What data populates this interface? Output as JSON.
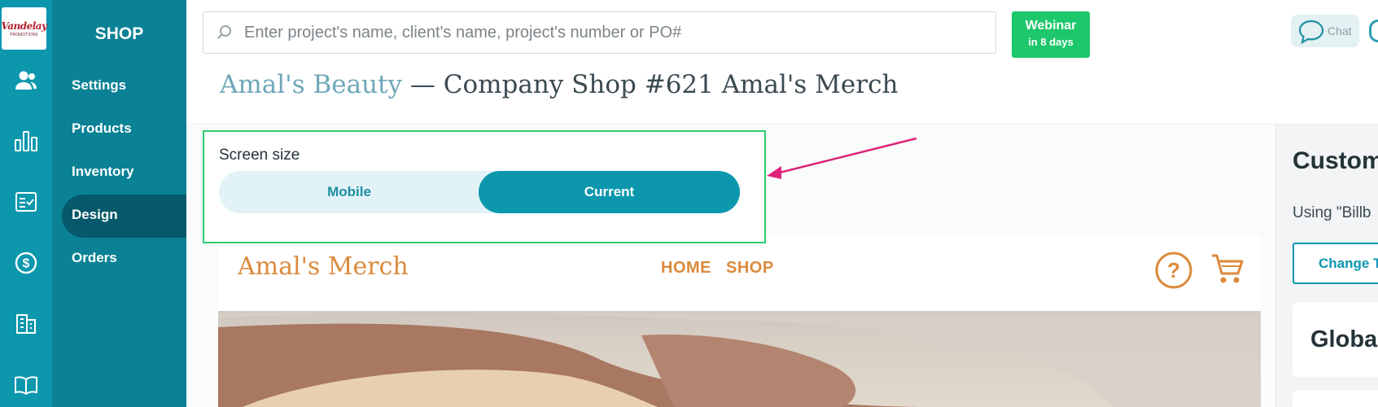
{
  "logo": {
    "name": "Vandelay",
    "tagline": "PROMOTIONS"
  },
  "sidebar": {
    "title": "SHOP",
    "items": [
      {
        "label": "Settings"
      },
      {
        "label": "Products"
      },
      {
        "label": "Inventory"
      },
      {
        "label": "Design",
        "active": true
      },
      {
        "label": "Orders"
      }
    ]
  },
  "rail_icons": [
    "users-icon",
    "bar-chart-icon",
    "checklist-icon",
    "dollar-icon",
    "building-icon",
    "book-icon"
  ],
  "search": {
    "placeholder": "Enter project's name, client's name, project's number or PO#",
    "value": ""
  },
  "webinar": {
    "title": "Webinar",
    "subtitle": "in 8 days"
  },
  "chat": {
    "label": "Chat"
  },
  "heading": {
    "client": "Amal's Beauty",
    "rest": " — Company Shop #621 Amal's Merch"
  },
  "screen_size": {
    "label": "Screen size",
    "options": [
      {
        "label": "Mobile",
        "selected": false
      },
      {
        "label": "Current",
        "selected": true
      }
    ]
  },
  "store": {
    "name": "Amal's Merch",
    "nav": [
      "HOME",
      "SHOP"
    ]
  },
  "right_panel": {
    "title": "Custom",
    "subtitle": "Using \"Billb",
    "change_button": "Change T",
    "global_title": "Globa"
  },
  "colors": {
    "rail": "#0c97ad",
    "sidebar": "#0a8195",
    "sidebar_active": "#06596a",
    "accent": "#0c97ad",
    "webinar": "#1dc76b",
    "highlight_box": "#2ecc71",
    "arrow": "#e0237a",
    "store_accent": "#dc8a3d"
  }
}
